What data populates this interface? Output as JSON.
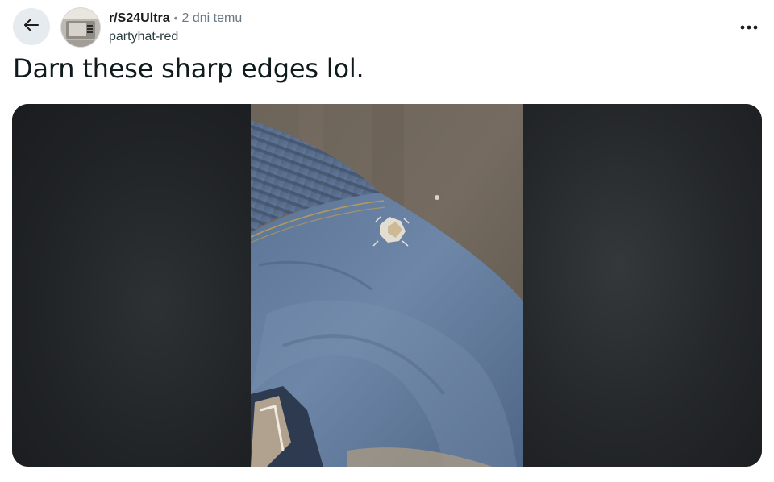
{
  "header": {
    "back_icon": "arrow-left-icon",
    "subreddit": "r/S24Ultra",
    "separator": "•",
    "timestamp": "2 dni temu",
    "username": "partyhat-red",
    "more_icon": "more-horizontal-icon"
  },
  "post": {
    "title": "Darn these sharp edges lol.",
    "image_alt": "Photo of torn jeans knee with a small hole"
  },
  "colors": {
    "back_button_bg": "#e5ebee",
    "title_text": "#0f1a1c",
    "meta_text": "#6b7781",
    "media_frame_bg": "#222528"
  }
}
